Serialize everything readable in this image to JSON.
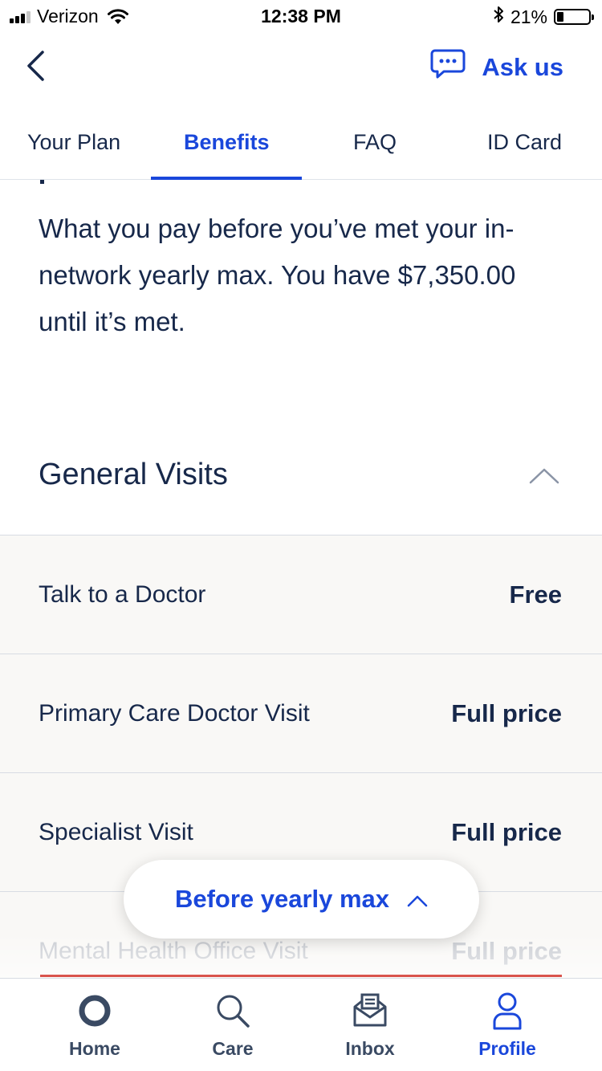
{
  "status_bar": {
    "carrier": "Verizon",
    "time": "12:38 PM",
    "battery": "21%",
    "battery_level": 0.21
  },
  "header": {
    "back_icon": "chevron-left-icon",
    "ask_us_label": "Ask us",
    "ask_us_icon": "chat-bubble-icon"
  },
  "tabs": [
    {
      "label": "Your Plan",
      "active": false
    },
    {
      "label": "Benefits",
      "active": true
    },
    {
      "label": "FAQ",
      "active": false
    },
    {
      "label": "ID Card",
      "active": false
    }
  ],
  "content": {
    "description": "What you pay before you’ve met your in-network yearly max. You have $7,350.00 until it’s met.",
    "section_title": "General Visits",
    "rows": [
      {
        "label": "Talk to a Doctor",
        "value": "Free"
      },
      {
        "label": "Primary Care Doctor Visit",
        "value": "Full price"
      },
      {
        "label": "Specialist Visit",
        "value": "Full price"
      },
      {
        "label": "Mental Health Office Visit",
        "value": "Full price"
      }
    ]
  },
  "floating_pill": {
    "label": "Before yearly max"
  },
  "bottom_nav": [
    {
      "label": "Home",
      "icon": "home-ring-icon",
      "active": false
    },
    {
      "label": "Care",
      "icon": "search-icon",
      "active": false
    },
    {
      "label": "Inbox",
      "icon": "inbox-icon",
      "active": false
    },
    {
      "label": "Profile",
      "icon": "person-icon",
      "active": true
    }
  ],
  "colors": {
    "accent": "#1a47db",
    "text": "#17284a",
    "row_background": "#f9f8f6",
    "alert_line": "#d9544d"
  }
}
